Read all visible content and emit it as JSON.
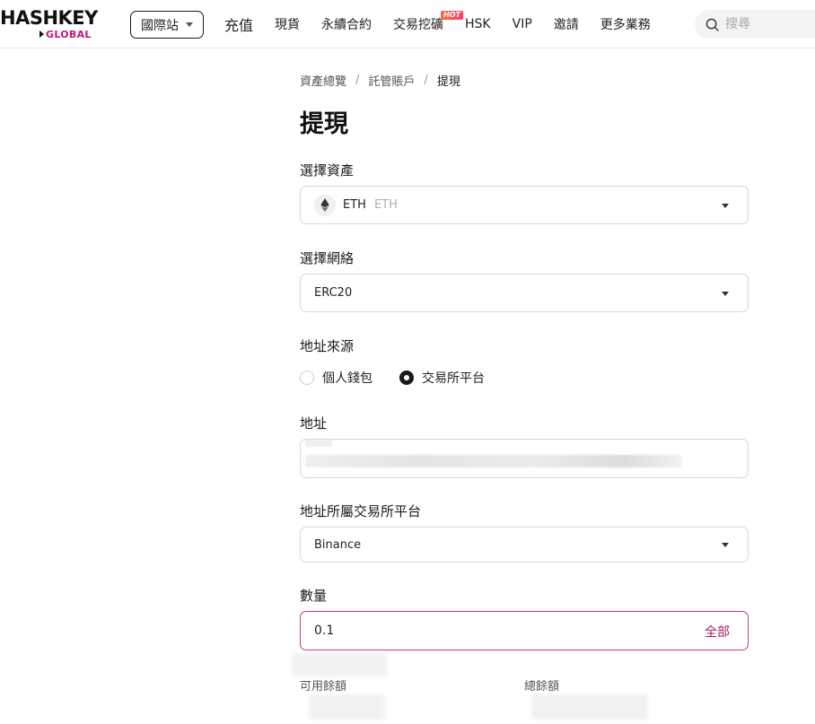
{
  "header": {
    "logo_main": "HASHKEY",
    "logo_sub": "GLOBAL",
    "site_selector": "國際站",
    "nav": [
      {
        "label": "充值"
      },
      {
        "label": "現貨"
      },
      {
        "label": "永續合約"
      },
      {
        "label": "交易挖礦",
        "badge": "HOT"
      },
      {
        "label": "HSK"
      },
      {
        "label": "VIP"
      },
      {
        "label": "邀請"
      },
      {
        "label": "更多業務"
      }
    ],
    "search_placeholder": "搜尋"
  },
  "breadcrumb": [
    "資產總覽",
    "託管賬戶",
    "提現"
  ],
  "page_title": "提現",
  "asset": {
    "label": "選擇資產",
    "symbol": "ETH",
    "name": "ETH"
  },
  "network": {
    "label": "選擇網絡",
    "value": "ERC20"
  },
  "address_source": {
    "label": "地址來源",
    "options": [
      "個人錢包",
      "交易所平台"
    ],
    "selected": "交易所平台"
  },
  "address": {
    "label": "地址"
  },
  "exchange": {
    "label": "地址所屬交易所平台",
    "value": "Binance"
  },
  "amount": {
    "label": "數量",
    "value": "0.1",
    "all_label": "全部"
  },
  "balances": {
    "available_label": "可用餘額",
    "total_label": "總餘額"
  },
  "colors": {
    "brand": "#c4127e",
    "amount_border": "#c23f74",
    "all_text": "#a21a6a"
  }
}
